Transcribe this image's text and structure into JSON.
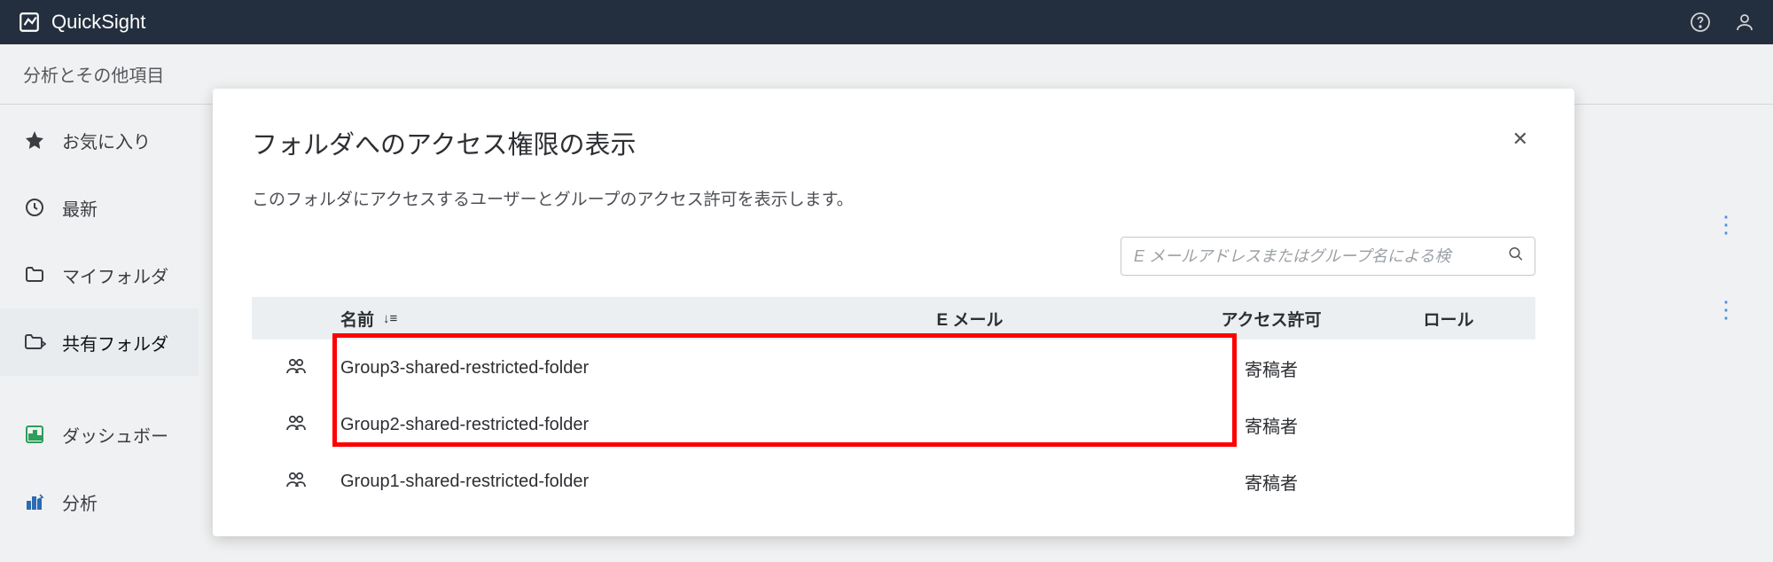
{
  "header": {
    "app_title": "QuickSight"
  },
  "breadcrumb": "分析とその他項目",
  "sidebar": {
    "items": [
      {
        "label": "お気に入り"
      },
      {
        "label": "最新"
      },
      {
        "label": "マイフォルダ"
      },
      {
        "label": "共有フォルダ"
      },
      {
        "label": "ダッシュボー"
      },
      {
        "label": "分析"
      }
    ]
  },
  "modal": {
    "title": "フォルダへのアクセス権限の表示",
    "subtitle": "このフォルダにアクセスするユーザーとグループのアクセス許可を表示します。",
    "search_placeholder": "E メールアドレスまたはグループ名による検",
    "columns": {
      "name": "名前",
      "email": "E メール",
      "access": "アクセス許可",
      "role": "ロール"
    },
    "rows": [
      {
        "name": "Group3-shared-restricted-folder",
        "email": "",
        "access": "寄稿者",
        "role": ""
      },
      {
        "name": "Group2-shared-restricted-folder",
        "email": "",
        "access": "寄稿者",
        "role": ""
      },
      {
        "name": "Group1-shared-restricted-folder",
        "email": "",
        "access": "寄稿者",
        "role": ""
      }
    ]
  }
}
